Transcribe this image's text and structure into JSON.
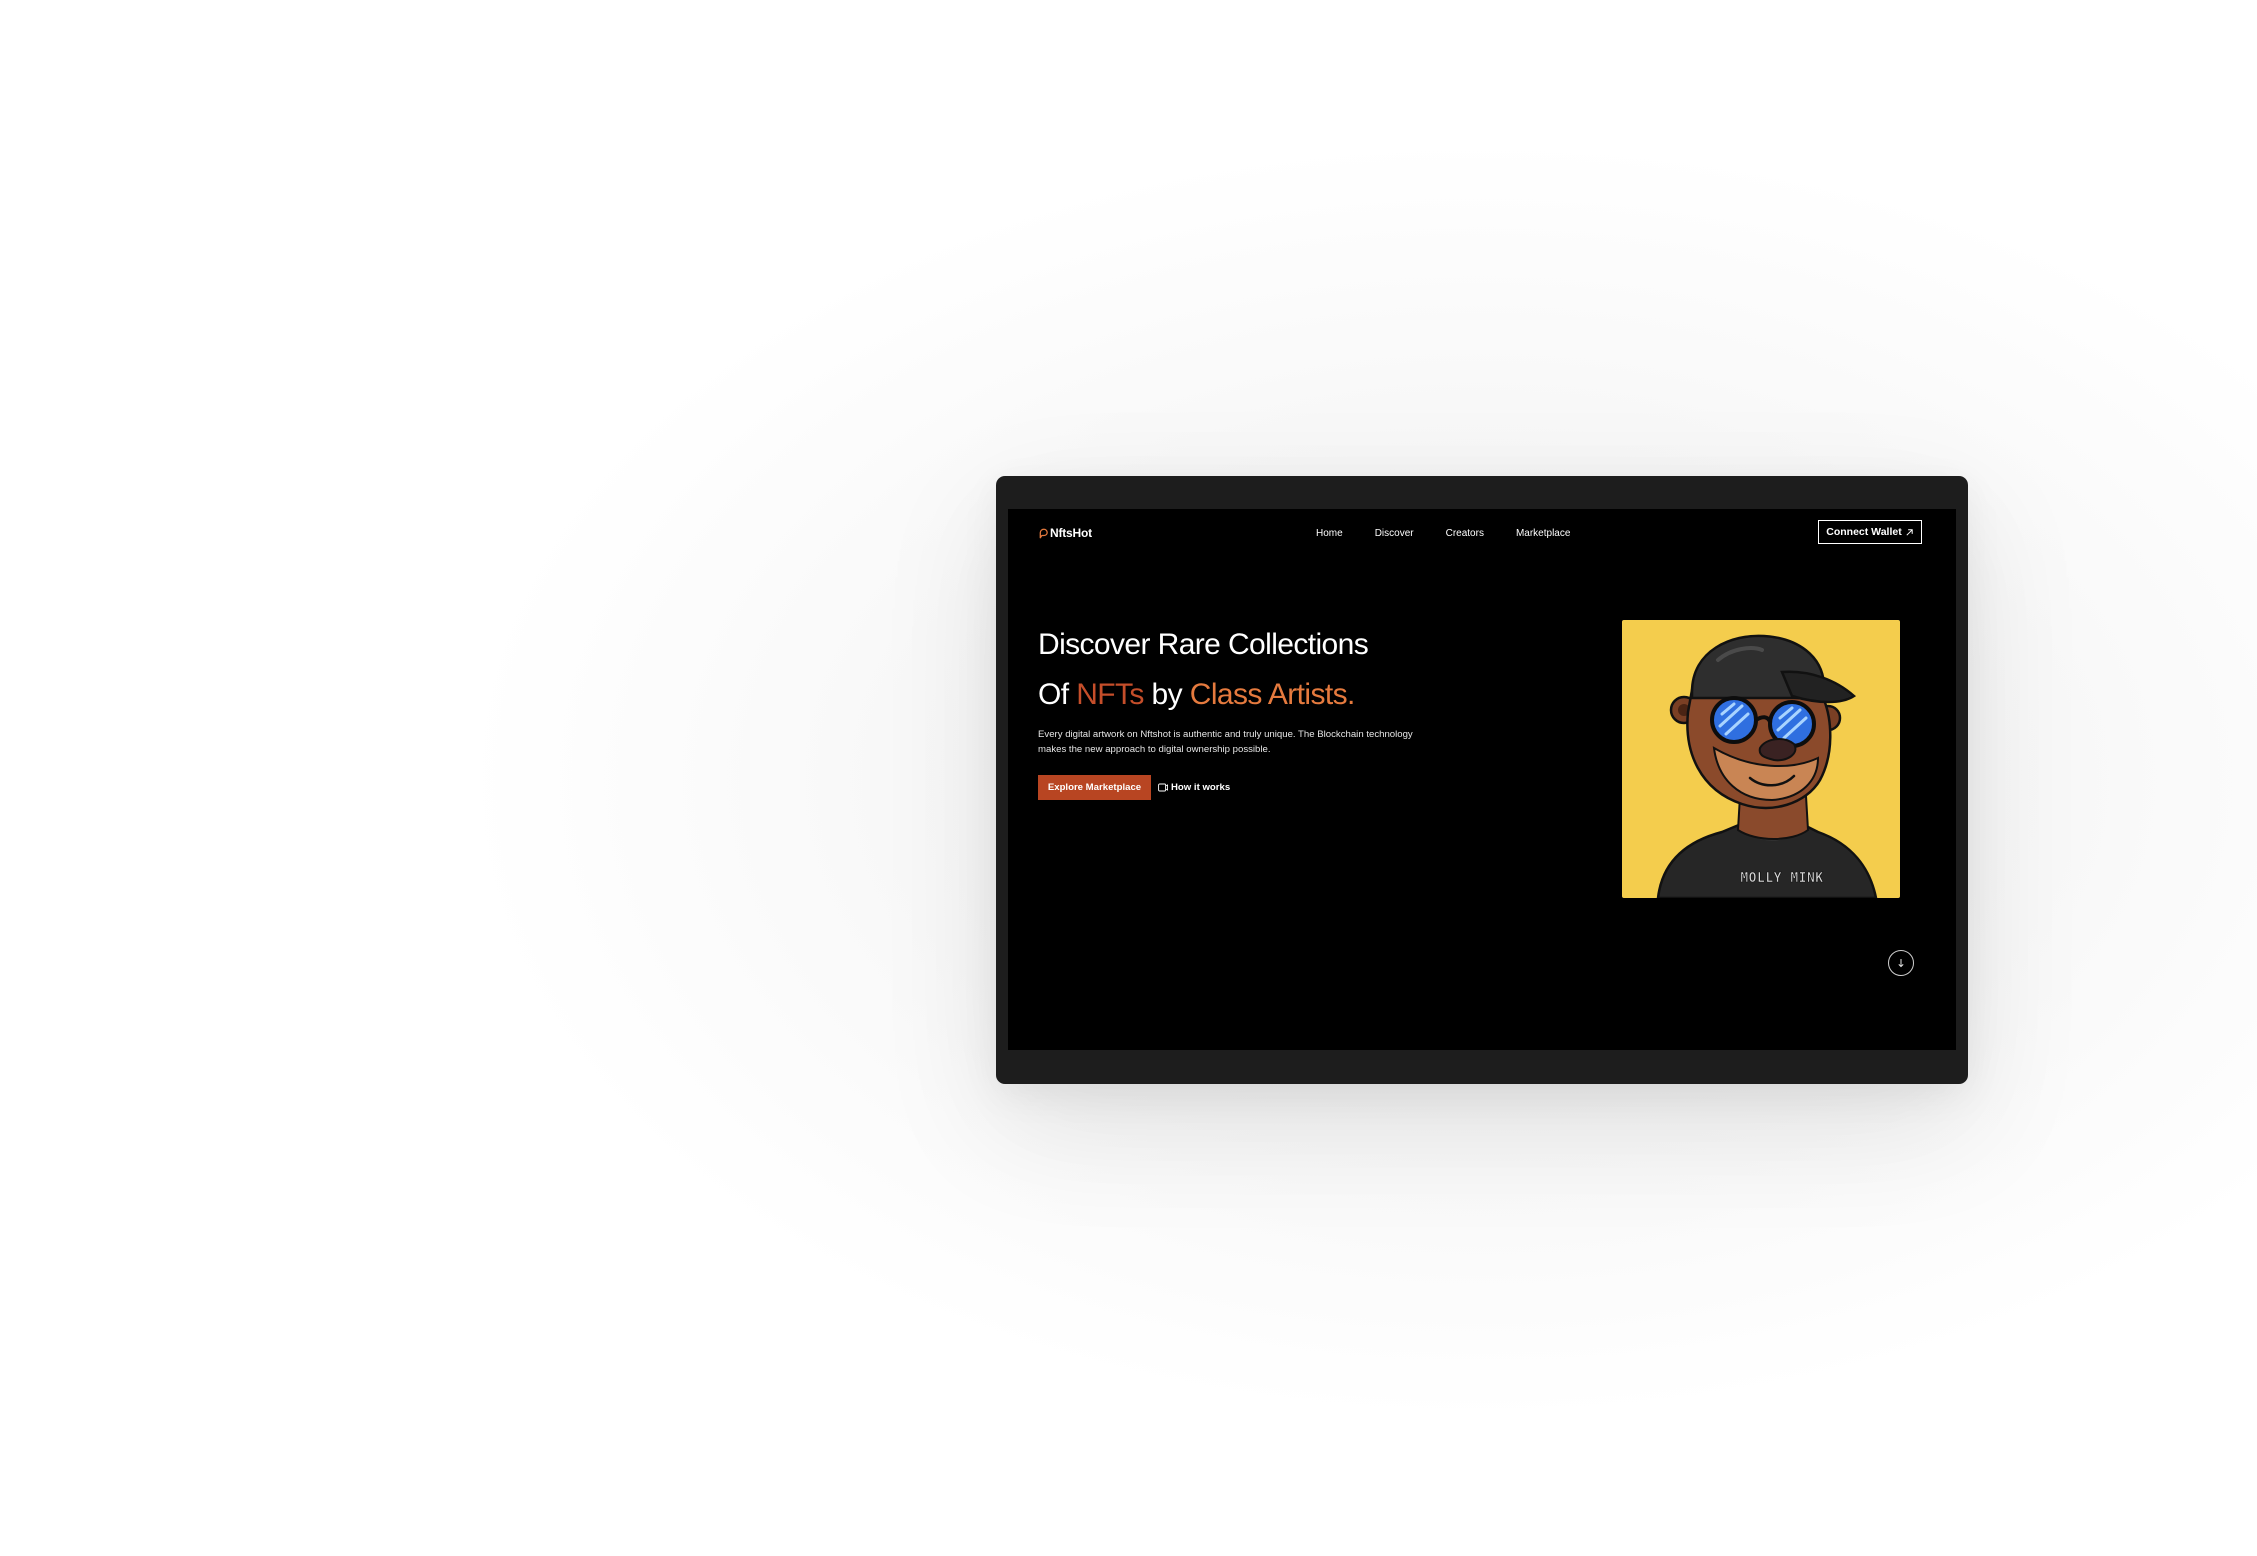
{
  "brand": {
    "name": "NftsHot",
    "accent": "#e57a3e"
  },
  "nav": {
    "items": [
      "Home",
      "Discover",
      "Creators",
      "Marketplace"
    ],
    "connect_wallet": "Connect Wallet"
  },
  "hero": {
    "line1": "Discover Rare Collections",
    "line2_prefix": "Of ",
    "highlight1": "NFTs",
    "line2_mid": " by ",
    "highlight2": "Class Artists.",
    "description": "Every digital artwork on Nftshot is authentic and truly unique. The Blockchain technology makes the new approach to digital ownership possible.",
    "primary_cta": "Explore Marketplace",
    "secondary_cta": "How it works"
  },
  "artwork": {
    "shirt_text": "MOLLY MINK",
    "background": "#f4cd4d"
  },
  "icons": {
    "logo": "flame-pin-icon",
    "connect": "arrow-up-right-icon",
    "how": "play-icon",
    "scroll": "arrow-down-icon"
  },
  "colors": {
    "primary_button": "#b84522",
    "highlight_dark": "#c54e2a",
    "highlight_light": "#e57a3e"
  }
}
